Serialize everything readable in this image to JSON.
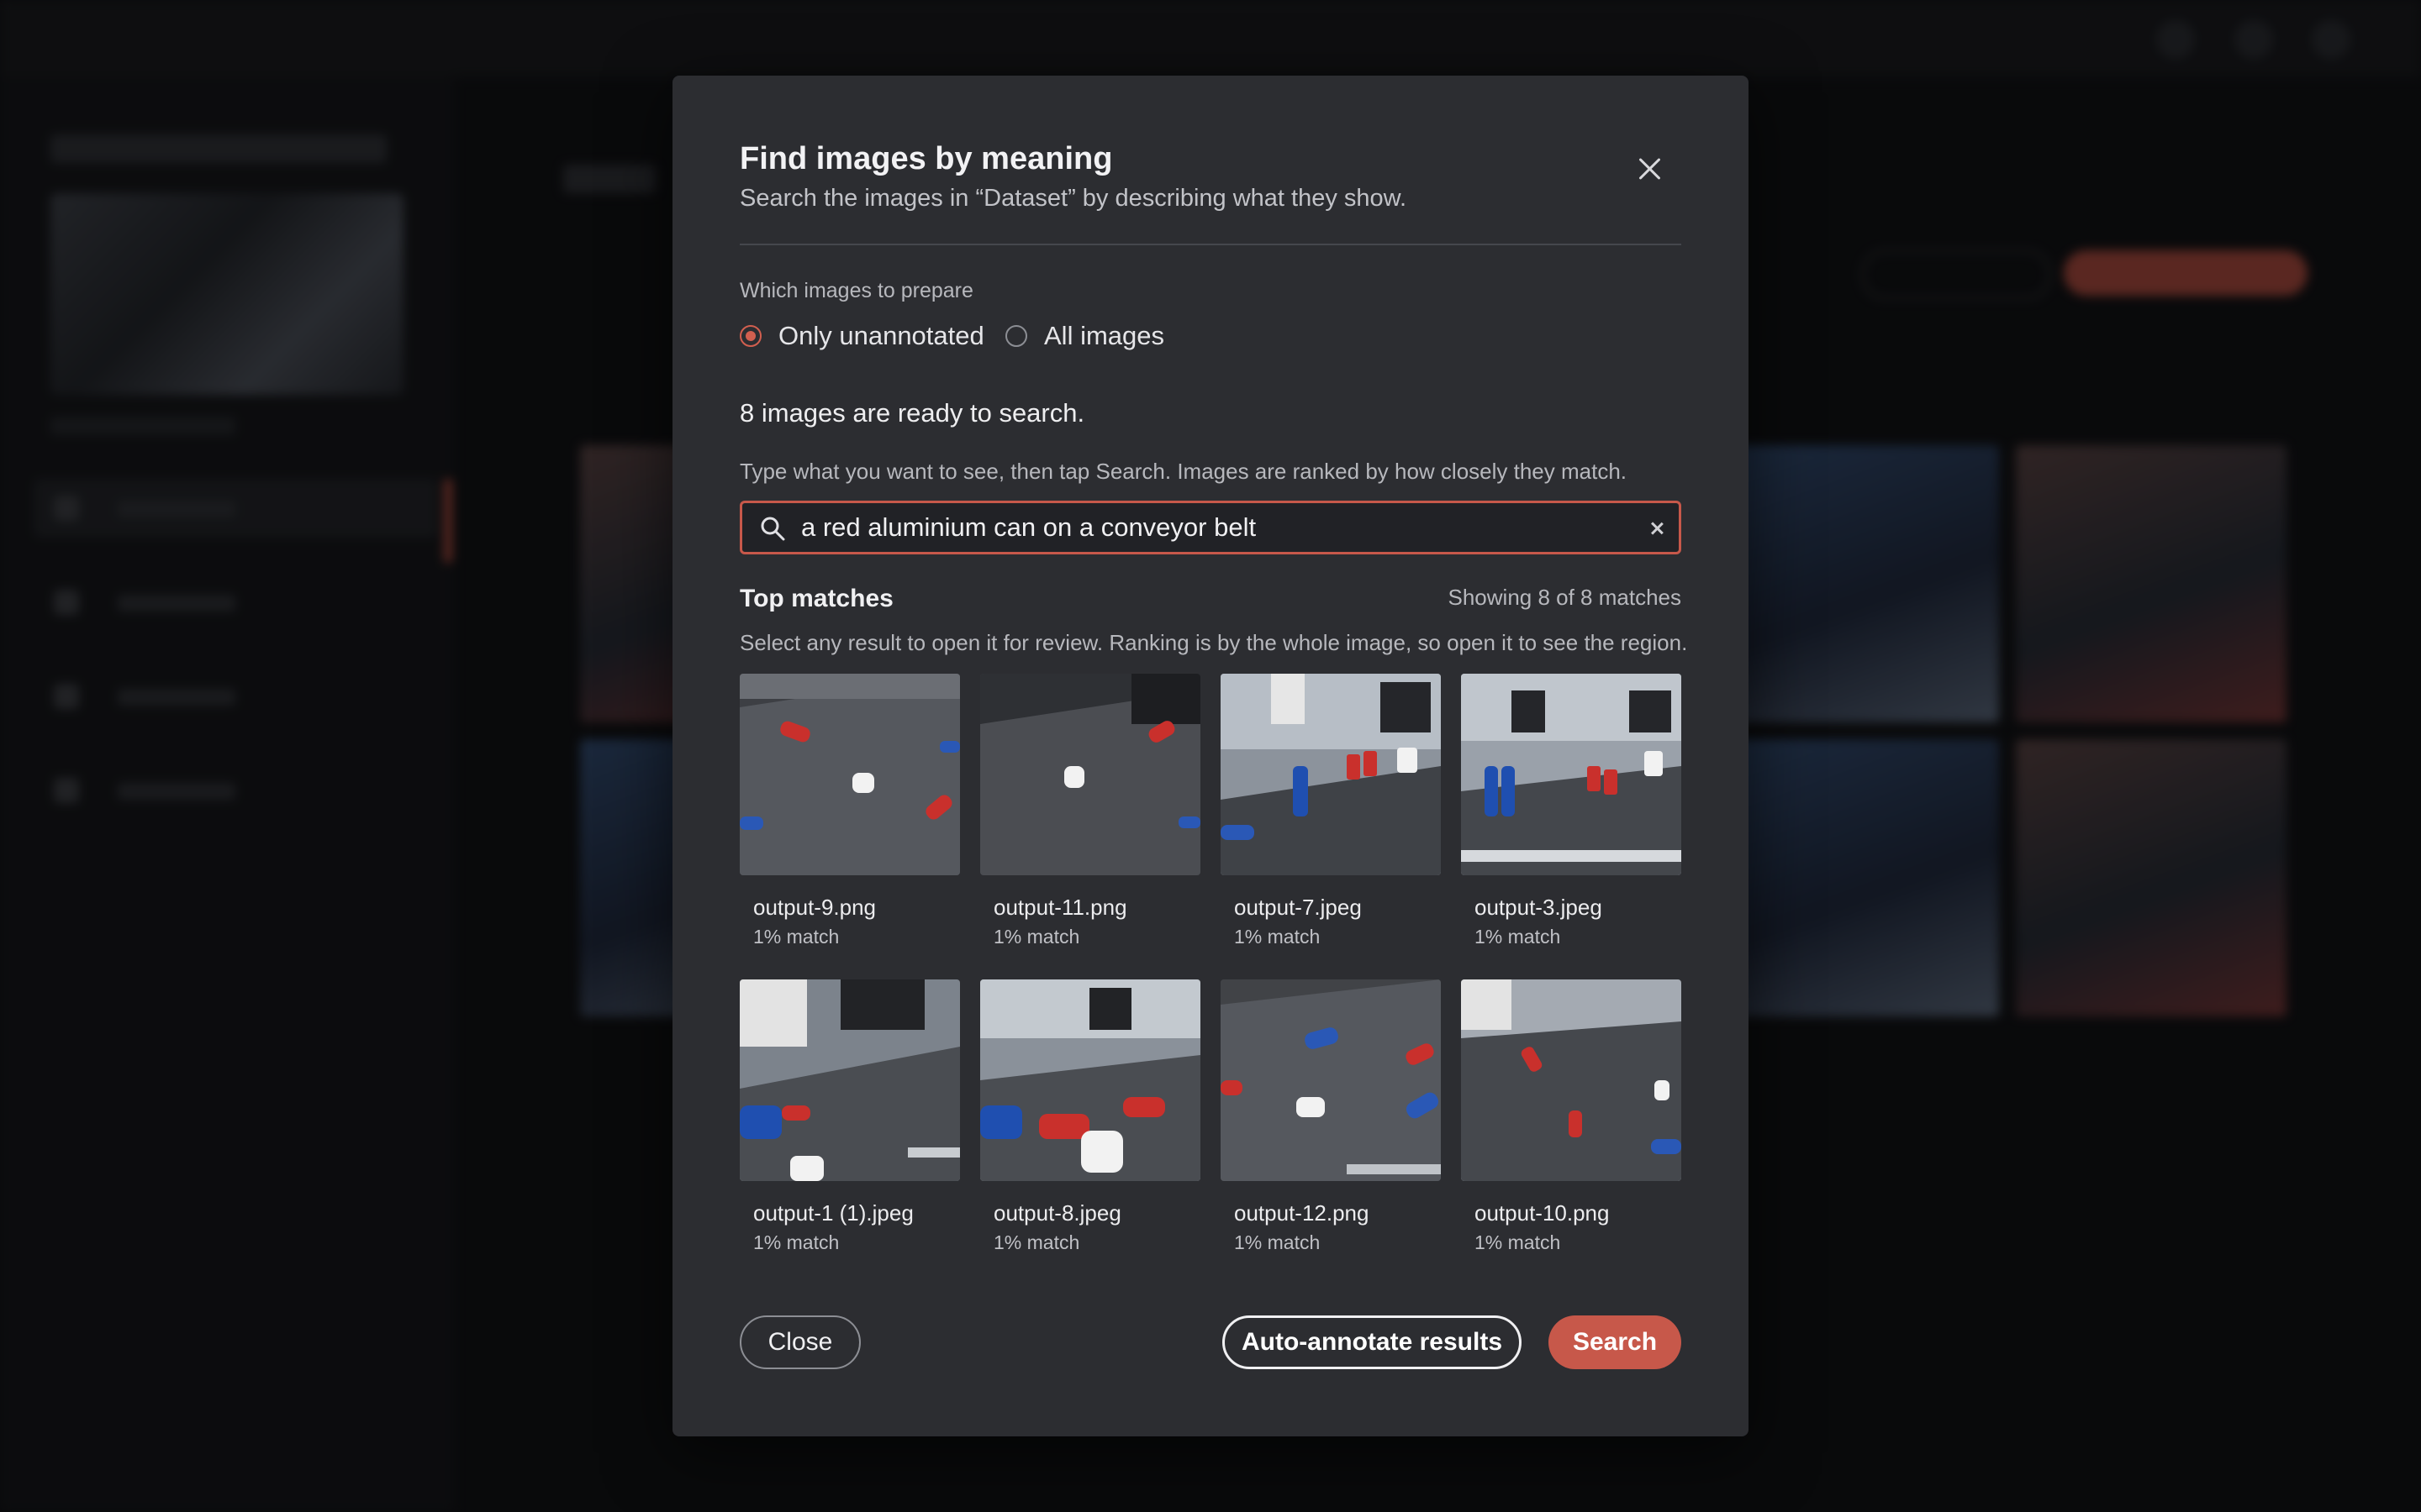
{
  "dialog": {
    "title": "Find images by meaning",
    "subtitle": "Search the images in “Dataset” by describing what they show.",
    "prepare_label": "Which images to prepare",
    "options": [
      {
        "label": "Only unannotated",
        "selected": true
      },
      {
        "label": "All images",
        "selected": false
      }
    ],
    "ready_text": "8 images are ready to search.",
    "hint": "Type what you want to see, then tap Search. Images are ranked by how closely they match.",
    "search": {
      "value": "a red aluminium can on a conveyor belt",
      "placeholder": ""
    },
    "matches": {
      "title": "Top matches",
      "count": "Showing 8 of 8 matches",
      "hint": "Select any result to open it for review. Ranking is by the whole image, so open it to see the region."
    },
    "results": [
      {
        "name": "output-9.png",
        "score": "1% match"
      },
      {
        "name": "output-11.png",
        "score": "1% match"
      },
      {
        "name": "output-7.jpeg",
        "score": "1% match"
      },
      {
        "name": "output-3.jpeg",
        "score": "1% match"
      },
      {
        "name": "output-1 (1).jpeg",
        "score": "1% match"
      },
      {
        "name": "output-8.jpeg",
        "score": "1% match"
      },
      {
        "name": "output-12.png",
        "score": "1% match"
      },
      {
        "name": "output-10.png",
        "score": "1% match"
      }
    ],
    "buttons": {
      "close": "Close",
      "auto_annotate": "Auto-annotate results",
      "search": "Search"
    }
  },
  "colors": {
    "accent": "#c7584a",
    "dialog_bg": "#2c2d31",
    "page_bg": "#16171a"
  },
  "icons": {
    "search": "search-icon",
    "close": "close-icon",
    "clear": "clear-icon"
  }
}
